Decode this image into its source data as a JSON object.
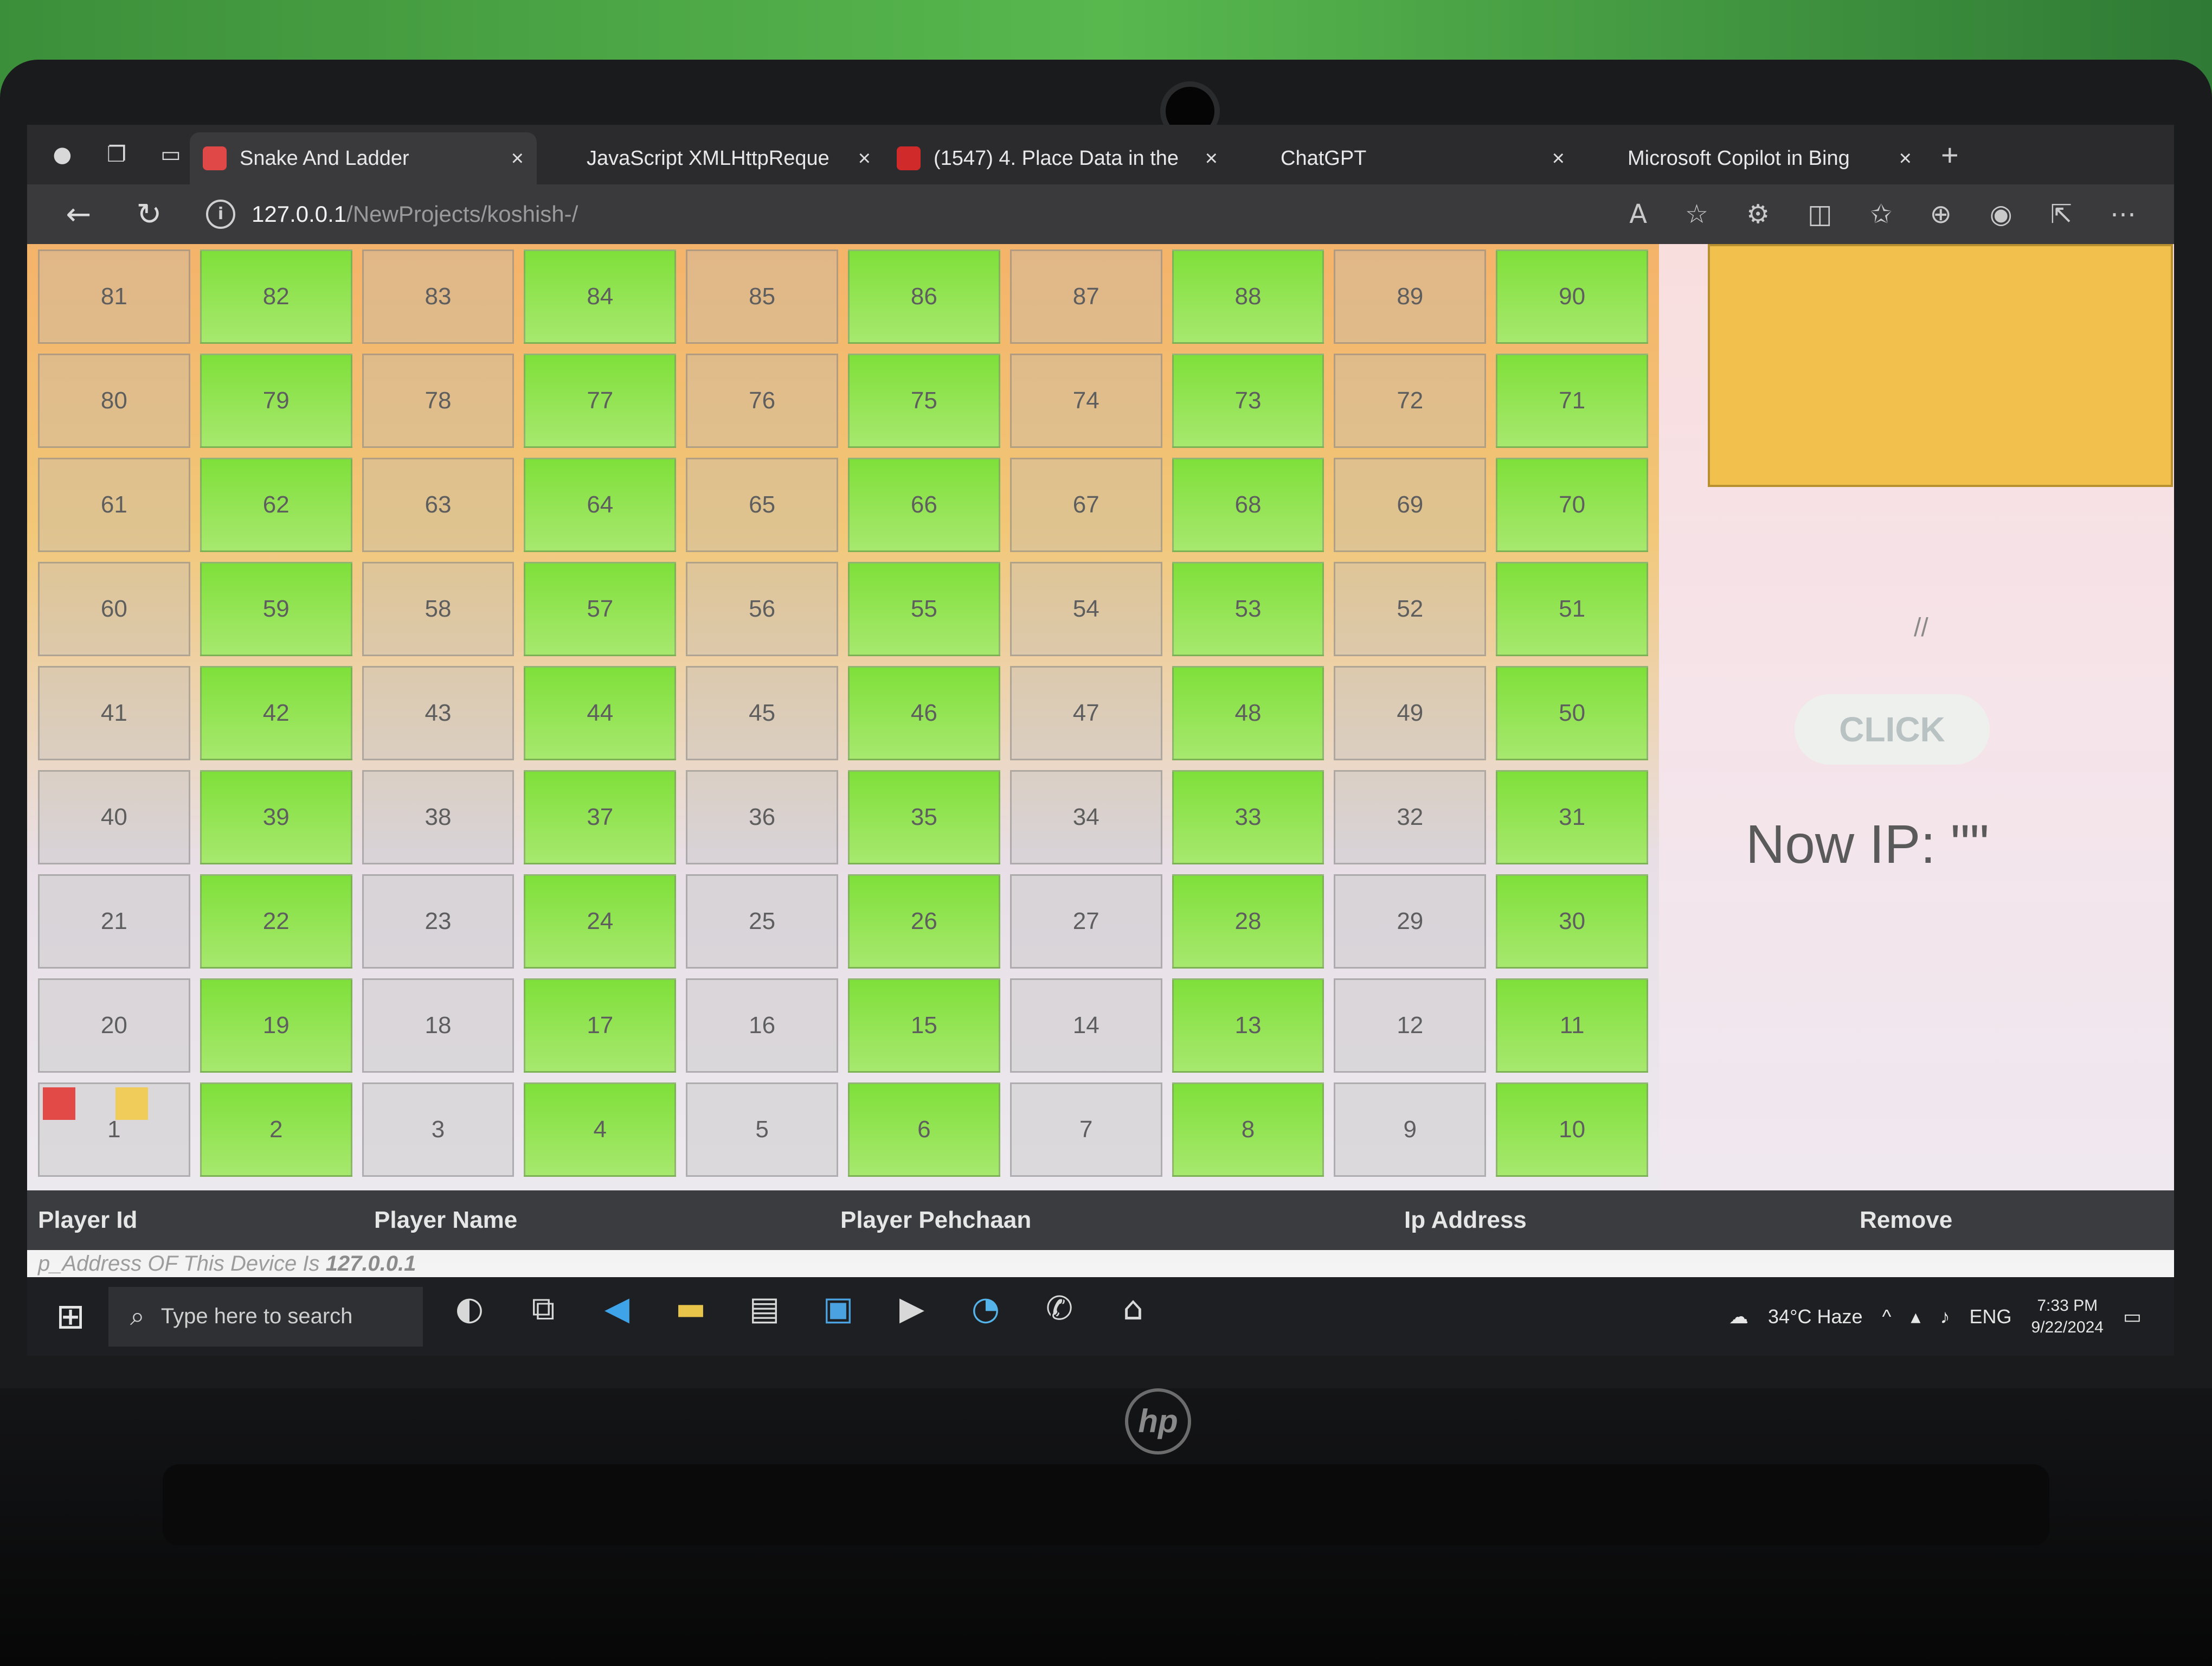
{
  "browser": {
    "tabs": [
      {
        "title": "Snake And Ladder",
        "active": true,
        "fav_color": "#e04848"
      },
      {
        "title": "JavaScript XMLHttpReque",
        "active": false,
        "fav_color": "#2b2b2d"
      },
      {
        "title": "(1547) 4. Place Data in the",
        "active": false,
        "fav_color": "#d02a2a"
      },
      {
        "title": "ChatGPT",
        "active": false,
        "fav_color": "#2b2b2d"
      },
      {
        "title": "Microsoft Copilot in Bing",
        "active": false,
        "fav_color": "#2b2b2d"
      }
    ],
    "url_host": "127.0.0.1",
    "url_path": "/NewProjects/koshish-/"
  },
  "board": {
    "rows": [
      [
        81,
        82,
        83,
        84,
        85,
        86,
        87,
        88,
        89,
        90
      ],
      [
        80,
        79,
        78,
        77,
        76,
        75,
        74,
        73,
        72,
        71
      ],
      [
        61,
        62,
        63,
        64,
        65,
        66,
        67,
        68,
        69,
        70
      ],
      [
        60,
        59,
        58,
        57,
        56,
        55,
        54,
        53,
        52,
        51
      ],
      [
        41,
        42,
        43,
        44,
        45,
        46,
        47,
        48,
        49,
        50
      ],
      [
        40,
        39,
        38,
        37,
        36,
        35,
        34,
        33,
        32,
        31
      ],
      [
        21,
        22,
        23,
        24,
        25,
        26,
        27,
        28,
        29,
        30
      ],
      [
        20,
        19,
        18,
        17,
        16,
        15,
        14,
        13,
        12,
        11
      ],
      [
        1,
        2,
        3,
        4,
        5,
        6,
        7,
        8,
        9,
        10
      ]
    ],
    "player_colors": [
      "#e14a47",
      "#f0cd5a"
    ]
  },
  "side": {
    "slash_text": "//",
    "click_label": "CLICK",
    "now_ip": "Now IP: \"\""
  },
  "table": {
    "headers": [
      "Player Id",
      "Player Name",
      "Player Pehchaan",
      "Ip Address",
      "Remove"
    ]
  },
  "footer": {
    "device_ip_prefix": "p_Address OF This Device Is ",
    "device_ip_value": "127.0.0.1"
  },
  "taskbar": {
    "search_placeholder": "Type here to search",
    "weather": "34°C  Haze",
    "language": "ENG",
    "time": "7:33 PM",
    "date": "9/22/2024"
  }
}
